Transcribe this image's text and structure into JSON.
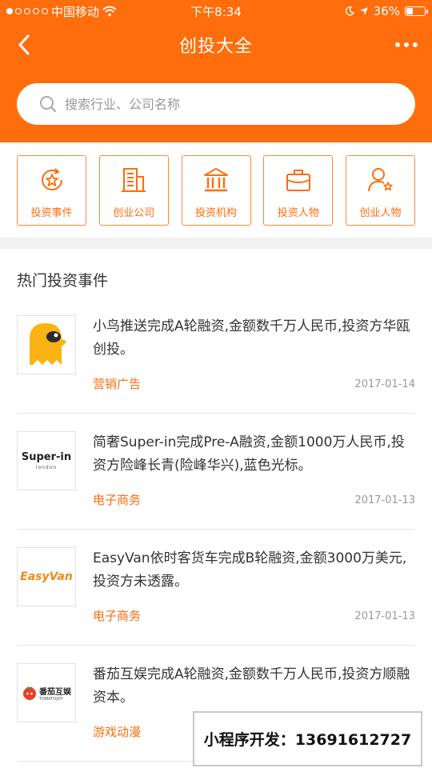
{
  "status_bar": {
    "carrier": "中国移动",
    "time": "下午8:34",
    "battery": "36%",
    "battery_level": 0.36
  },
  "header": {
    "title": "创投大全"
  },
  "search": {
    "placeholder": "搜索行业、公司名称"
  },
  "categories": [
    {
      "label": "投资事件",
      "icon": "star-refresh-icon"
    },
    {
      "label": "创业公司",
      "icon": "company-building-icon"
    },
    {
      "label": "投资机构",
      "icon": "institution-icon"
    },
    {
      "label": "投资人物",
      "icon": "briefcase-icon"
    },
    {
      "label": "创业人物",
      "icon": "person-star-icon"
    }
  ],
  "section": {
    "title": "热门投资事件"
  },
  "events": [
    {
      "text": "小鸟推送完成A轮融资,金额数千万人民币,投资方华瓯创投。",
      "tag": "营销广告",
      "date": "2017-01-14",
      "logo": "bird-logo"
    },
    {
      "text": "简奢Super-in完成Pre-A融资,金额1000万人民币,投资方险峰长青(险峰华兴),蓝色光标。",
      "tag": "电子商务",
      "date": "2017-01-13",
      "logo": "superin-logo",
      "logo_text": "Super-in",
      "logo_sub": "london"
    },
    {
      "text": "EasyVan依时客货车完成B轮融资,金额3000万美元,投资方未透露。",
      "tag": "电子商务",
      "date": "2017-01-13",
      "logo": "easyvan-logo",
      "logo_text": "EasyVan"
    },
    {
      "text": "番茄互娱完成A轮融资,金额数千万人民币,投资方顺融资本。",
      "tag": "游戏动漫",
      "date": "",
      "logo": "tomato-logo",
      "logo_text": "番茄互娱",
      "logo_sub": "TOMATOJOY"
    }
  ],
  "watermark": "小程序开发：13691612727"
}
